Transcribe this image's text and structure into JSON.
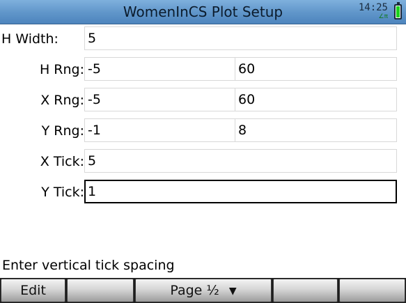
{
  "header": {
    "title": "WomenInCS Plot Setup",
    "clock": "14:25",
    "radio_glyph": "∠π"
  },
  "fields": {
    "h_width": {
      "label": "H Width:",
      "value": "5"
    },
    "h_rng": {
      "label": "H Rng:",
      "min": "-5",
      "max": "60"
    },
    "x_rng": {
      "label": "X Rng:",
      "min": "-5",
      "max": "60"
    },
    "y_rng": {
      "label": "Y Rng:",
      "min": "-1",
      "max": "8"
    },
    "x_tick": {
      "label": "X Tick:",
      "value": "5"
    },
    "y_tick": {
      "label": "Y Tick:",
      "value": "1"
    }
  },
  "hint": "Enter vertical tick spacing",
  "softkeys": {
    "edit": "Edit",
    "page": "Page ½",
    "page_icon": "▼"
  },
  "colors": {
    "titlebar": "#5f95c9",
    "battery": "#1cd11c",
    "selected_border": "#000000"
  }
}
